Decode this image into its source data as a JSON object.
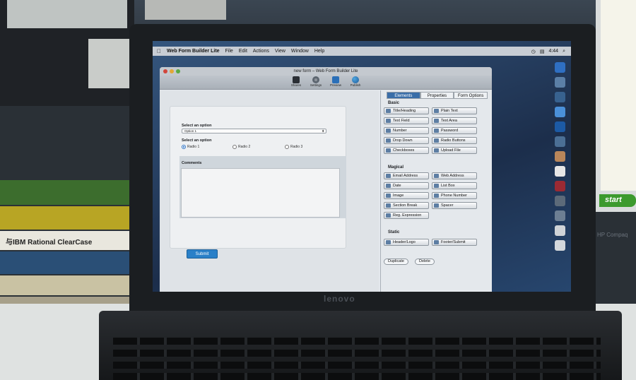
{
  "menubar": {
    "apple": "",
    "app_name": "Web Form Builder Lite",
    "items": [
      "File",
      "Edit",
      "Actions",
      "View",
      "Window",
      "Help"
    ],
    "clock": "4:44"
  },
  "window": {
    "title": "new form – Web Form Builder Lite",
    "toolbar": [
      {
        "label": "Shares",
        "icon": "shares-icon"
      },
      {
        "label": "Settings",
        "icon": "gear-icon"
      },
      {
        "label": "Preview",
        "icon": "preview-icon"
      },
      {
        "label": "Publish",
        "icon": "globe-icon"
      }
    ]
  },
  "form": {
    "select_label": "Select an option",
    "select_value": "Option 1",
    "radio_label": "Select an option",
    "radios": [
      {
        "label": "Radio 1",
        "checked": true
      },
      {
        "label": "Radio 2",
        "checked": false
      },
      {
        "label": "Radio 3",
        "checked": false
      }
    ],
    "comments_label": "Comments",
    "submit_label": "Submit"
  },
  "panel": {
    "tabs": [
      "Elements",
      "Properties",
      "Form Options"
    ],
    "active_tab": "Elements",
    "basic_title": "Basic",
    "basic": [
      "Title/Heading",
      "Plain Text",
      "Text Field",
      "Text Area",
      "Number",
      "Password",
      "Drop Down",
      "Radio Buttons",
      "Checkboxes",
      "Upload File"
    ],
    "magical_title": "Magical",
    "magical": [
      "Email Address",
      "Web Address",
      "Date",
      "List Box",
      "Image",
      "Phone Number",
      "Section Break",
      "Spacer",
      "Reg. Expression"
    ],
    "static_title": "Static",
    "static": [
      "Header/Logo",
      "Footer/Submit"
    ],
    "duplicate": "Duplicate",
    "delete": "Delete"
  },
  "background": {
    "start_button": "start",
    "laptop_brand": "lenovo",
    "book_title": "与IBM Rational ClearCase",
    "monitor_brand": "HP Compaq"
  },
  "colors": {
    "accent": "#2a80c8",
    "tab_active": "#3a6ea8",
    "desktop": "#27466e"
  }
}
